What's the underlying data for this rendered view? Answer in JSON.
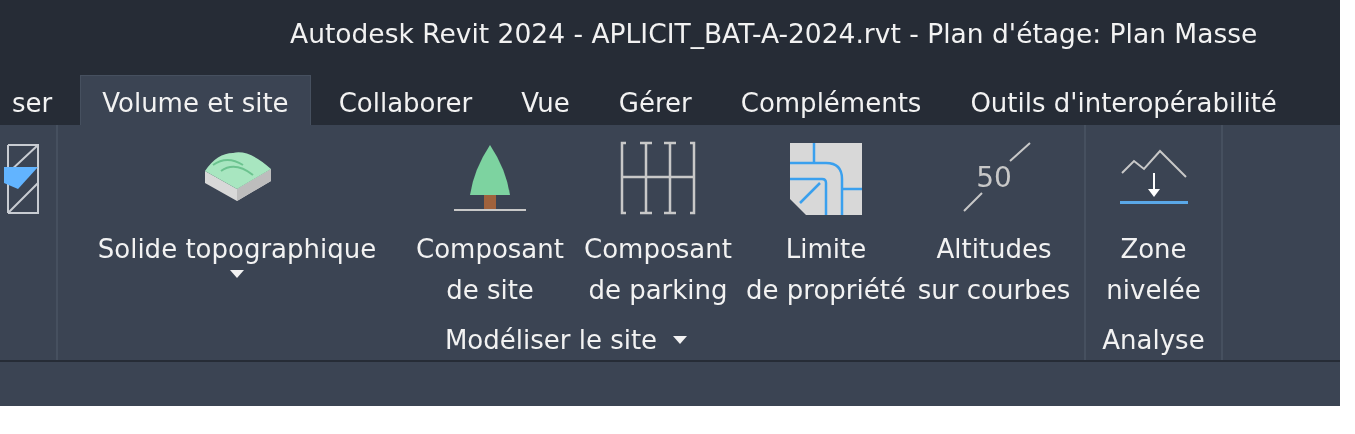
{
  "window": {
    "title": "Autodesk Revit 2024 - APLICIT_BAT-A-2024.rvt - Plan d'étage: Plan Masse"
  },
  "tabs": [
    {
      "label": "ser",
      "selected": false
    },
    {
      "label": "Volume et site",
      "selected": true
    },
    {
      "label": "Collaborer",
      "selected": false
    },
    {
      "label": "Vue",
      "selected": false
    },
    {
      "label": "Gérer",
      "selected": false
    },
    {
      "label": "Compléments",
      "selected": false
    },
    {
      "label": "Outils d'interopérabilité",
      "selected": false
    }
  ],
  "panels": [
    {
      "label": "Modéliser le site",
      "dropdown": true,
      "buttons": [
        {
          "kind": "topo",
          "lines": [
            "Solide topographique"
          ],
          "dropdown": true
        },
        {
          "kind": "tree",
          "lines": [
            "Composant",
            "de site"
          ],
          "dropdown": false
        },
        {
          "kind": "parking",
          "lines": [
            "Composant",
            "de parking"
          ],
          "dropdown": false
        },
        {
          "kind": "property",
          "lines": [
            "Limite",
            "de propriété"
          ],
          "dropdown": false
        },
        {
          "kind": "elevation",
          "lines": [
            "Altitudes",
            "sur courbes"
          ],
          "icon_text": "50",
          "dropdown": false
        }
      ]
    },
    {
      "label": "Analyse",
      "dropdown": false,
      "buttons": [
        {
          "kind": "grade",
          "lines": [
            "Zone",
            "nivelée"
          ],
          "dropdown": false
        }
      ]
    }
  ]
}
